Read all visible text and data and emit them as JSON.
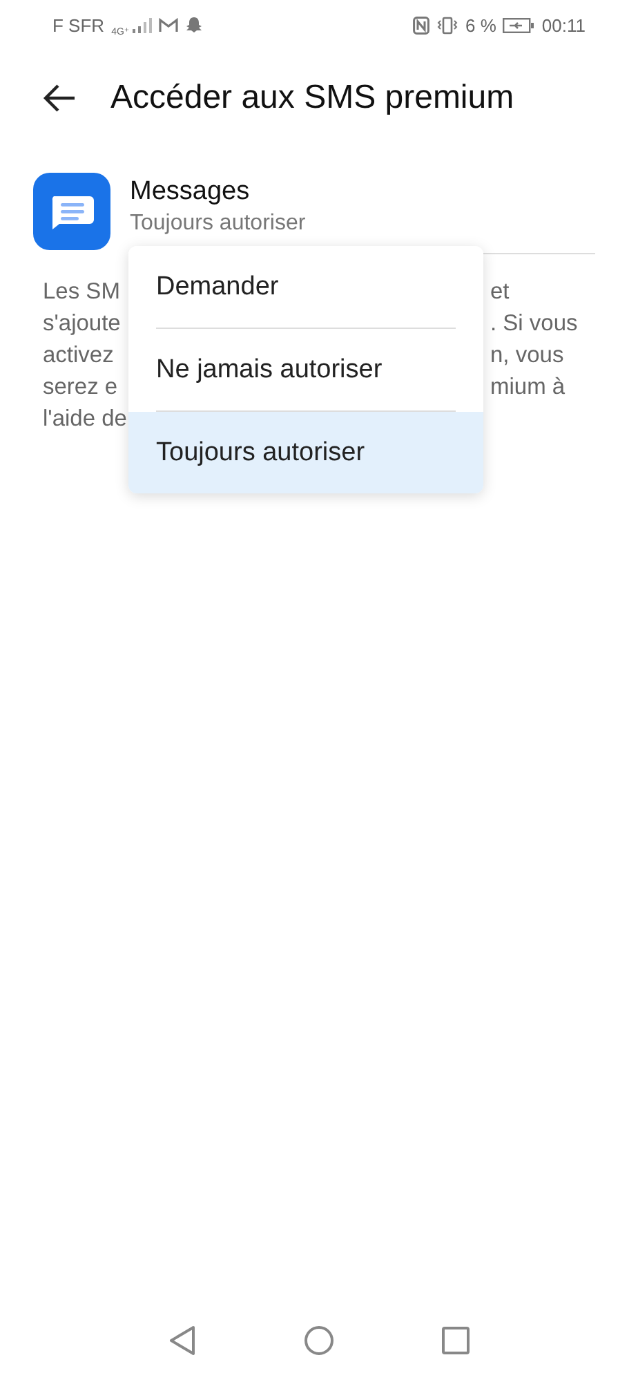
{
  "status_bar": {
    "carrier": "F SFR",
    "network": "4G⁺",
    "battery": "6 %",
    "time": "00:11"
  },
  "header": {
    "title": "Accéder aux SMS premium"
  },
  "app": {
    "name": "Messages",
    "setting": "Toujours autoriser"
  },
  "description": {
    "lines": [
      {
        "left": "Les SM",
        "right": "et"
      },
      {
        "left": "s'ajoute",
        "right": ". Si vous"
      },
      {
        "left": "activez",
        "right": "n, vous"
      },
      {
        "left": "serez e",
        "right": "mium à"
      },
      {
        "left": "l'aide de"
      }
    ]
  },
  "menu": {
    "options": [
      {
        "label": "Demander",
        "selected": false
      },
      {
        "label": "Ne jamais autoriser",
        "selected": false
      },
      {
        "label": "Toujours autoriser",
        "selected": true
      }
    ]
  }
}
